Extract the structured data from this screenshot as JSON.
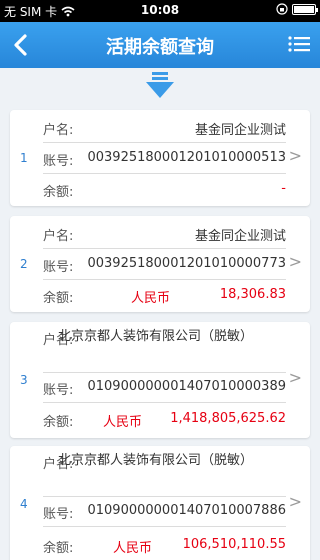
{
  "status_bar": {
    "carrier": "无 SIM 卡",
    "time": "10:08"
  },
  "nav": {
    "title": "活期余额查询",
    "back_icon": "back-arrow-icon",
    "menu_icon": "menu-list-icon"
  },
  "labels": {
    "name": "户名:",
    "account": "账号:",
    "balance": "余额:"
  },
  "accounts": [
    {
      "index": "1",
      "name": "基金同企业测试",
      "account": "003925180001201010000513",
      "currency": "",
      "balance": "-"
    },
    {
      "index": "2",
      "name": "基金同企业测试",
      "account": "003925180001201010000773",
      "currency": "人民币",
      "balance": "18,306.83"
    },
    {
      "index": "3",
      "name": "北京京都人装饰有限公司（脱敏）",
      "account": "010900000001407010000389",
      "currency": "人民币",
      "balance": "1,418,805,625.62"
    },
    {
      "index": "4",
      "name": "北京京都人装饰有限公司（脱敏）",
      "account": "010900000001407010007886",
      "currency": "人民币",
      "balance": "106,510,110.55"
    }
  ],
  "colors": {
    "nav_blue": "#2786d9",
    "balance_red": "#e60012"
  }
}
